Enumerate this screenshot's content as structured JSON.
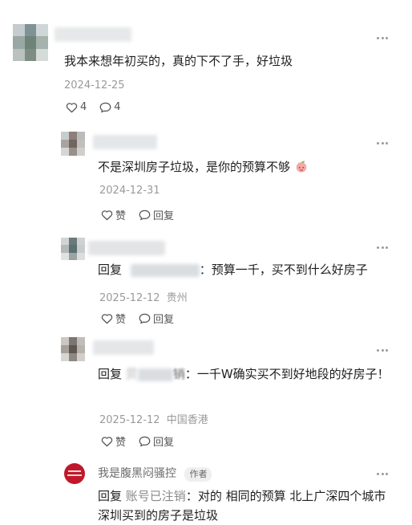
{
  "icons": {
    "like": "heart-outline-icon",
    "reply": "speech-bubble-icon",
    "more": "more-dots-icon"
  },
  "comments": [
    {
      "text": "我本来想年初买的，真的下不了手，好垃圾",
      "date": "2024-12-25",
      "likes": "4",
      "replies": "4"
    },
    {
      "text": "不是深圳房子垃圾，是你的预算不够",
      "date": "2024-12-31",
      "like_label": "赞",
      "reply_label": "回复"
    },
    {
      "reply_prefix": "回复",
      "text": "：预算一千，买不到什么好房子",
      "date": "2025-12-12",
      "location": "贵州",
      "like_label": "赞",
      "reply_label": "回复"
    },
    {
      "reply_prefix": "回复",
      "name_fragment": "贝",
      "name_suffix": "销",
      "text": "：一千W确实买不到好地段的好房子！",
      "date": "2025-12-12",
      "location": "中国香港",
      "like_label": "赞",
      "reply_label": "回复"
    },
    {
      "username": "我是腹黑闷骚控",
      "author_tag": "作者",
      "reply_prefix": "回复",
      "reply_target": "账号已注销",
      "text": "：对的 相同的预算 北上广深四个城市 深圳买到的房子是垃圾"
    }
  ]
}
